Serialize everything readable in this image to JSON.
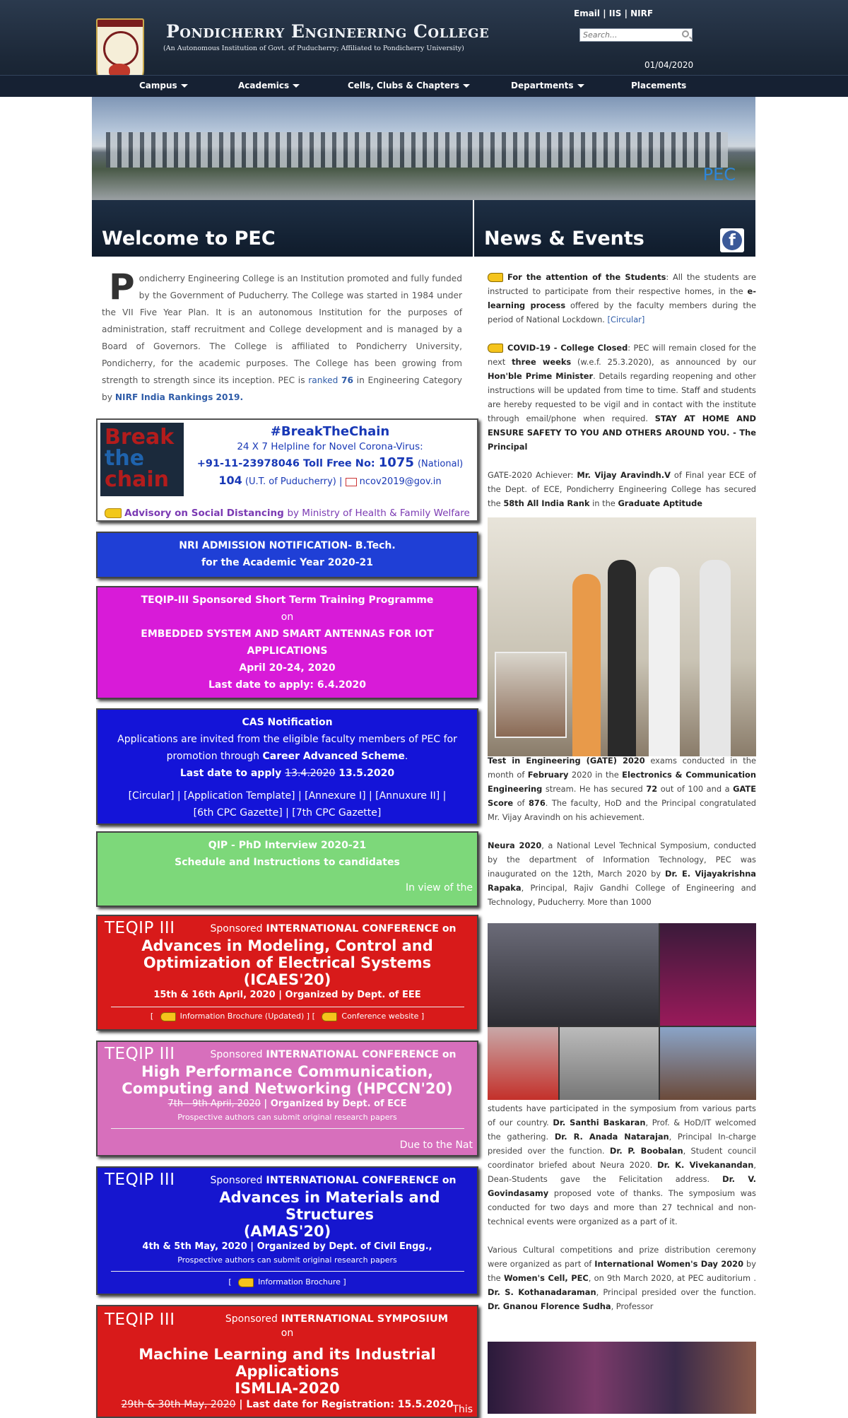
{
  "header": {
    "college_name": "Pondicherry Engineering College",
    "college_sub": "(An Autonomous Institution of Govt. of Puducherry; Affiliated to Pondicherry University)",
    "links": [
      "Email",
      "IIS",
      "NIRF"
    ],
    "separator": "|",
    "search_placeholder": "Search...",
    "date": "01/04/2020"
  },
  "nav": {
    "items": [
      "Campus",
      "Academics",
      "Cells, Clubs & Chapters",
      "Departments",
      "Placements"
    ]
  },
  "banner": {
    "label": "PEC"
  },
  "welcome": {
    "heading": "Welcome to PEC",
    "drop": "P",
    "text": "ondicherry Engineering College is an Institution promoted and fully funded by the Government of Puducherry. The College was started in 1984 under the VII Five Year Plan. It is an autonomous Institution for the purposes of administration, staff recruitment and College development and is managed by a Board of Governors. The College is affiliated to Pondicherry University, Pondicherry, for the academic purposes. The College has been growing from strength to strength since its inception. PEC is ",
    "ranked": "ranked",
    "rank": "76",
    "text2": " in Engineering Category by ",
    "nirf": "NIRF India Rankings 2019."
  },
  "breakthechain": {
    "img_line1": "Break",
    "img_line2": "the",
    "img_line3": "chain",
    "title": "#BreakTheChain",
    "helpline": "24 X 7 Helpline for Novel Corona-Virus:",
    "phone": "+91-11-23978046",
    "tollfree_label": "Toll Free No:",
    "tollfree": "1075",
    "national": "(National)",
    "local": "104",
    "local_label": "(U.T. of Puducherry)",
    "email": "ncov2019@gov.in",
    "advisory": "Advisory on Social Distancing",
    "advisory_by": "by Ministry of Health & Family Welfare"
  },
  "nri": {
    "line1": "NRI ADMISSION NOTIFICATION- B.Tech.",
    "line2": "for the Academic Year 2020-21"
  },
  "teqip_training": {
    "line1": "TEQIP-III Sponsored Short Term Training Programme",
    "line2": "on",
    "line3": "EMBEDDED SYSTEM AND SMART ANTENNAS FOR IOT APPLICATIONS",
    "line4": "April 20-24, 2020",
    "line5_label": "Last date to apply:",
    "line5": "6.4.2020"
  },
  "cas": {
    "title": "CAS Notification",
    "line1": "Applications are invited from the eligible faculty members of PEC for",
    "line2_pre": "promotion through",
    "line2_bold": "Career Advanced Scheme",
    "line2_post": ".",
    "line3_label": "Last date to apply",
    "line3_old": "13.4.2020",
    "line3_new": "13.5.2020",
    "links1": "[Circular] | [Application Template] | [Annexure I] | [Annuxure II] |",
    "links2": "[6th CPC Gazette] | [7th CPC Gazette]"
  },
  "qip": {
    "line1": "QIP - PhD Interview 2020-21",
    "line2": "Schedule and Instructions to candidates",
    "marquee": "In view of the"
  },
  "conf1": {
    "logo": "TEQIP III",
    "top_pre": "Sponsored",
    "top_upper": "INTERNATIONAL CONFERENCE",
    "top_post": "on",
    "title1": "Advances in Modeling, Control and",
    "title2": "Optimization of Electrical Systems (ICAES'20)",
    "dates": "15th & 16th April, 2020 | Organized by Dept. of EEE",
    "link1": "Information Brochure (Updated)",
    "link2": "Conference website"
  },
  "conf2": {
    "logo": "TEQIP III",
    "top_pre": "Sponsored",
    "top_upper": "INTERNATIONAL CONFERENCE",
    "top_post": "on",
    "title1": "High Performance Communication,",
    "title2": "Computing and Networking (HPCCN'20)",
    "dates_old": "7th - 9th April, 2020",
    "dates_post": "| Organized by Dept. of ECE",
    "small": "Prospective authors can submit original research papers",
    "marquee": "Due to the Nat"
  },
  "conf3": {
    "logo": "TEQIP III",
    "top_pre": "Sponsored",
    "top_upper": "INTERNATIONAL CONFERENCE",
    "top_post": "on",
    "title1": "Advances in Materials and Structures",
    "title2": "(AMAS'20)",
    "dates": "4th & 5th May, 2020 | Organized by Dept. of Civil Engg.,",
    "small": "Prospective authors can submit original research papers",
    "link1": "Information Brochure"
  },
  "symp": {
    "logo": "TEQIP III",
    "top_pre": "Sponsored",
    "top_upper": "INTERNATIONAL SYMPOSIUM",
    "top_post": "on",
    "title1": "Machine Learning and its Industrial Applications",
    "title2": "ISMLIA-2020",
    "dates_old": "29th & 30th May, 2020",
    "dates_post": "| Last date for Registration:",
    "dates_new": "15.5.2020",
    "marquee": "This"
  },
  "news": {
    "heading": "News & Events",
    "fb": "f",
    "n1_bold": "For the attention of the Students",
    "n1_a": ": All the students are instructed to participate from their respective homes, in the ",
    "n1_bold2": "e-learning process",
    "n1_b": " offered by the faculty members during the period of National Lockdown. ",
    "n1_link": "[Circular]",
    "n2_bold": "COVID-19 - College Closed",
    "n2_a": ": PEC will remain closed for the next ",
    "n2_bold2": "three weeks",
    "n2_b": " (w.e.f. 25.3.2020), as announced by our ",
    "n2_bold3": "Hon'ble Prime Minister",
    "n2_c": ". Details regarding reopening and other instructions will be updated from time to time. Staff and students are hereby requested to be vigil and in contact with the institute through email/phone when required. ",
    "n2_bold4": "STAY AT HOME AND ENSURE SAFETY TO YOU AND OTHERS AROUND YOU. - The Principal",
    "n3_a": "GATE-2020 Achiever: ",
    "n3_bold": "Mr. Vijay Aravindh.V",
    "n3_b": " of Final year ECE of the Dept. of ECE, Pondicherry Engineering College has secured the ",
    "n3_bold2": "58th All India Rank",
    "n3_c": " in the ",
    "n3_bold3": "Graduate Aptitude",
    "n3_d_bold": "Test in Engineering (GATE) 2020",
    "n3_d": " exams conducted in the month of ",
    "n3_d_bold2": "February",
    "n3_e": " 2020 in the ",
    "n3_e_bold": "Electronics & Communication Engineering",
    "n3_f": " stream. He has secured ",
    "n3_f_bold": "72",
    "n3_g": " out of 100 and a ",
    "n3_g_bold": "GATE Score",
    "n3_h": " of ",
    "n3_h_bold": "876",
    "n3_i": ". The faculty, HoD and the Principal congratulated Mr. Vijay Aravindh on his achievement.",
    "n4_bold": "Neura 2020",
    "n4_a": ", a National Level Technical Symposium, conducted by the department of Information Technology, PEC was inaugurated on the 12th, March 2020 by ",
    "n4_bold2": "Dr. E. Vijayakrishna Rapaka",
    "n4_b": ", Principal, Rajiv Gandhi College of Engineering and Technology, Puducherry. More than 1000",
    "n4_c": "students have participated in the symposium from various parts of our country. ",
    "n4_bold3": "Dr. Santhi Baskaran",
    "n4_d": ", Prof. & HoD/IT welcomed the gathering. ",
    "n4_bold4": "Dr. R. Anada Natarajan",
    "n4_e": ", Principal In-charge presided over the function. ",
    "n4_bold5": "Dr. P. Boobalan",
    "n4_f": ", Student council coordinator briefed about Neura 2020. ",
    "n4_bold6": "Dr. K. Vivekanandan",
    "n4_g": ", Dean-Students gave the Felicitation address. ",
    "n4_bold7": "Dr. V. Govindasamy",
    "n4_h": " proposed vote of thanks. The symposium was conducted for two days and more than 27 technical and non-technical events were organized as a part of it.",
    "n5_a": "Various Cultural competitions and prize distribution ceremony were organized as part of ",
    "n5_bold": "International Women's Day 2020",
    "n5_b": " by the ",
    "n5_bold2": "Women's Cell, PEC",
    "n5_c": ", on 9th March 2020, at PEC auditorium . ",
    "n5_bold3": "Dr. S. Kothanadaraman",
    "n5_d": ", Principal presided over the function. ",
    "n5_bold4": "Dr. Gnanou Florence Sudha",
    "n5_e": ", Professor"
  },
  "colors": {
    "nri": "#1f3fd6",
    "teqip": "#d81bd8",
    "cas": "#1414d8",
    "qip": "#7dd87a",
    "conf1": "#d81a1a",
    "conf2": "#d76fbc",
    "conf3": "#1616cf",
    "symp": "#d81a1a"
  }
}
